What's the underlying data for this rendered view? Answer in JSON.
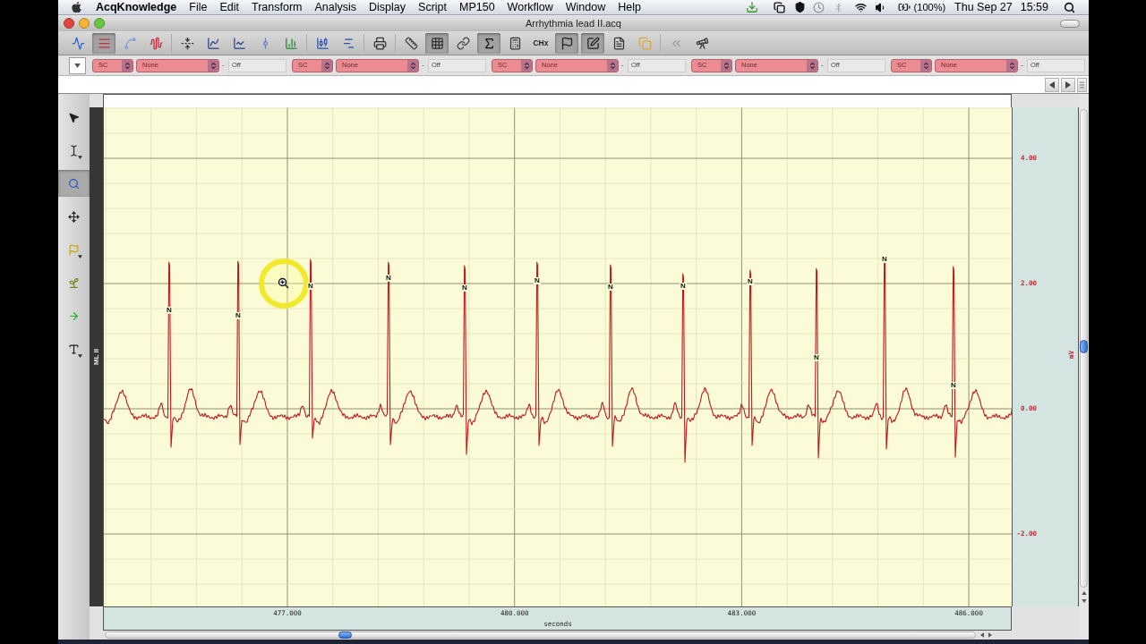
{
  "menu_bar": {
    "app_name": "AcqKnowledge",
    "items": [
      "File",
      "Edit",
      "Transform",
      "Analysis",
      "Display",
      "Script",
      "MP150",
      "Workflow",
      "Window",
      "Help"
    ],
    "status": {
      "battery": "(100%)",
      "date": "Thu Sep 27",
      "time": "15:59"
    }
  },
  "window": {
    "title": "Arrhythmia lead II.acq"
  },
  "toolbar": {
    "buttons": [
      {
        "selected": false
      },
      {
        "selected": true
      },
      {
        "selected": false
      },
      {
        "selected": false
      },
      {
        "selected": false
      },
      {
        "selected": false
      },
      {
        "selected": false
      },
      {
        "selected": false
      },
      {
        "selected": false
      },
      {
        "selected": false
      },
      {
        "selected": false
      },
      {
        "selected": false
      },
      {
        "selected": false
      },
      {
        "selected": true
      },
      {
        "selected": false
      },
      {
        "selected": true
      },
      {
        "selected": false
      },
      {
        "selected": false,
        "label": "CHx"
      },
      {
        "selected": true
      },
      {
        "selected": true
      },
      {
        "selected": false
      },
      {
        "selected": false
      },
      {
        "selected": false
      },
      {
        "selected": false
      }
    ]
  },
  "channel_bar": {
    "groups": [
      {
        "source": "SC",
        "function": "None",
        "operator": "-",
        "value": "Off"
      },
      {
        "source": "SC",
        "function": "None",
        "operator": "-",
        "value": "Off"
      },
      {
        "source": "SC",
        "function": "None",
        "operator": "-",
        "value": "Off"
      },
      {
        "source": "SC",
        "function": "None",
        "operator": "-",
        "value": "Off"
      },
      {
        "source": "SC",
        "function": "None",
        "operator": "-",
        "value": "Off"
      }
    ]
  },
  "tools": [
    {
      "selected": false
    },
    {
      "selected": false
    },
    {
      "selected": true
    },
    {
      "selected": false
    },
    {
      "selected": false
    },
    {
      "selected": false
    },
    {
      "selected": false
    },
    {
      "selected": false
    }
  ],
  "plot": {
    "channel_label": "ML II",
    "beat_labels": [
      "N",
      "N",
      "N",
      "N",
      "N",
      "N",
      "N",
      "N",
      "N",
      "N",
      "N",
      "N"
    ],
    "y_axis": {
      "unit": "mV",
      "ticks": [
        "4.00",
        "2.00",
        "0.00",
        "-2.00"
      ]
    },
    "x_axis": {
      "label": "seconds",
      "ticks": [
        "477.000",
        "480.000",
        "483.000",
        "486.000"
      ]
    }
  }
}
